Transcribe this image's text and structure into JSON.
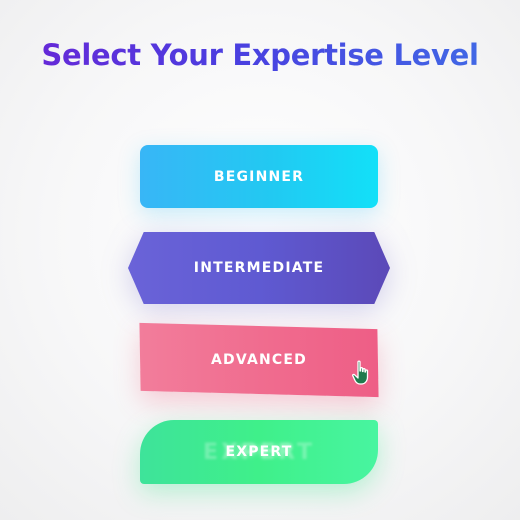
{
  "header": {
    "title": "Select Your Expertise Level"
  },
  "levels": [
    {
      "label": "BEGINNER",
      "color": "#22c9f2"
    },
    {
      "label": "INTERMEDIATE",
      "color": "#5f5ad2"
    },
    {
      "label": "ADVANCED",
      "color": "#f06b8e"
    },
    {
      "label": "EXPERT",
      "color": "#3ff08a"
    }
  ],
  "cursor": {
    "icon": "hand-pointer-icon",
    "color": "#1f7a4d"
  }
}
